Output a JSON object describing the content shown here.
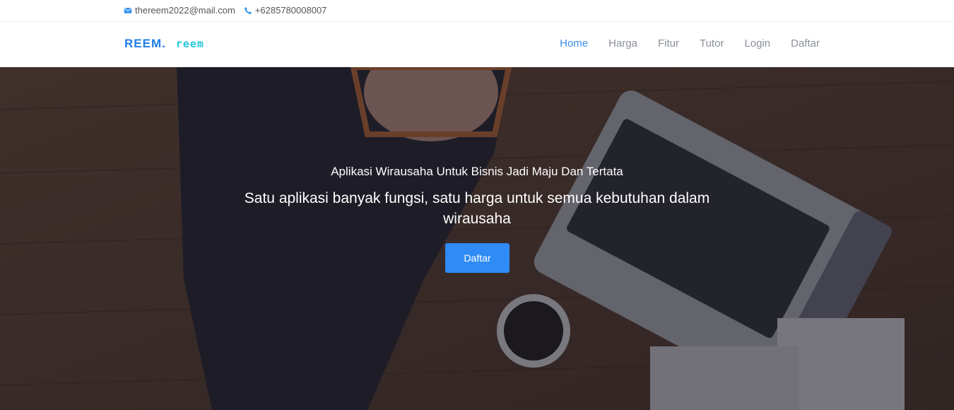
{
  "topbar": {
    "email": "thereem2022@mail.com",
    "phone": "+6285780008007",
    "email_icon": "envelope-icon",
    "phone_icon": "phone-icon"
  },
  "brand": {
    "name": "REEM.",
    "logo_text": "reem"
  },
  "nav": {
    "items": [
      {
        "label": "Home",
        "active": true
      },
      {
        "label": "Harga",
        "active": false
      },
      {
        "label": "Fitur",
        "active": false
      },
      {
        "label": "Tutor",
        "active": false
      },
      {
        "label": "Login",
        "active": false
      },
      {
        "label": "Daftar",
        "active": false
      }
    ]
  },
  "hero": {
    "subtitle": "Aplikasi Wirausaha Untuk Bisnis Jadi Maju Dan Tertata",
    "title": "Satu aplikasi banyak fungsi, satu harga untuk semua kebutuhan dalam wirausaha",
    "button_label": "Daftar"
  },
  "colors": {
    "accent": "#2f8bf5",
    "brand": "#1e7ee8",
    "logo": "#26c6da",
    "nav_active": "#3b8ee6"
  }
}
